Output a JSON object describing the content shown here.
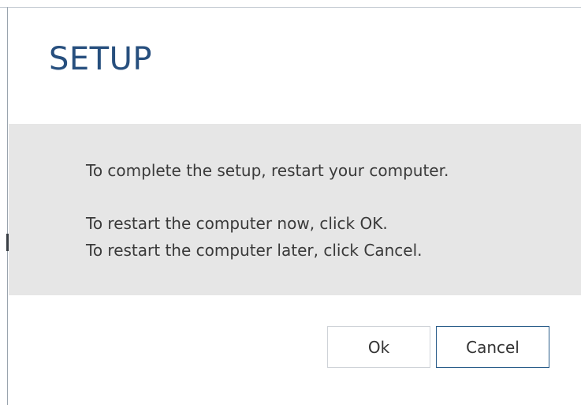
{
  "dialog": {
    "title": "SETUP",
    "message_lines": [
      "To complete the setup, restart your computer.",
      "To restart the computer now, click OK.",
      "To restart the computer later, click Cancel."
    ],
    "buttons": {
      "ok_label": "Ok",
      "cancel_label": "Cancel"
    }
  },
  "colors": {
    "title": "#274f7e",
    "panel_bg": "#e6e6e6",
    "cancel_border": "#2a5d8a"
  }
}
